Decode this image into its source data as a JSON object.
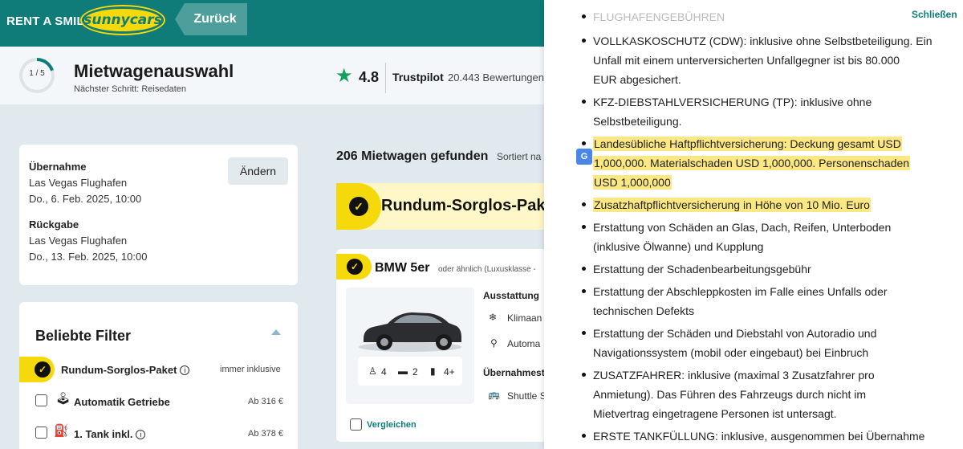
{
  "topbar": {
    "brand_text": "RENT A SMILE",
    "logo_text": "sunnycars",
    "back_label": "Zurück"
  },
  "header": {
    "step": "1 / 5",
    "progress_fraction": 0.2,
    "title": "Mietwagenauswahl",
    "next_step": "Nächster Schritt: Reisedaten",
    "rating": "4.8",
    "trustpilot_label": "Trustpilot",
    "reviews": "20.443 Bewertungen"
  },
  "rental": {
    "pickup_label": "Übernahme",
    "pickup_location": "Las Vegas Flughafen",
    "pickup_date": "Do., 6. Feb. 2025, 10:00",
    "return_label": "Rückgabe",
    "return_location": "Las Vegas Flughafen",
    "return_date": "Do., 13. Feb. 2025, 10:00",
    "change_label": "Ändern"
  },
  "filters": {
    "title": "Beliebte Filter",
    "items": [
      {
        "name": "Rundum-Sorglos-Paket",
        "extra": "immer inklusive"
      },
      {
        "name": "Automatik Getriebe",
        "extra": "Ab 316 €"
      },
      {
        "name": "1. Tank inkl.",
        "extra": "Ab 378 €"
      }
    ]
  },
  "results": {
    "count_text": "206 Mietwagen gefunden",
    "sorted_text": "Sortiert na",
    "package_title": "Rundum-Sorglos-Pak"
  },
  "car": {
    "name": "BMW 5er",
    "subtitle": "oder ähnlich (Luxusklasse -",
    "seats": "4",
    "bags": "2",
    "small_bags": "4+",
    "equipment_head": "Ausstattung",
    "feature1": "Klimaan",
    "feature2": "Automa",
    "pickup_head": "Übernahmest",
    "shuttle": "Shuttle S",
    "compare": "Vergleichen"
  },
  "panel": {
    "close_label": "Schließen",
    "lines": [
      "FLUGHAFENGEBÜHREN",
      "VOLLKASKOSCHUTZ (CDW): inklusive ohne Selbstbeteiligung. Ein",
      "Unfall mit einem unterversicherten Unfallgegner ist bis 80.000",
      "EUR abgesichert.",
      "KFZ-DIEBSTAHLVERSICHERUNG (TP): inklusive ohne",
      "Selbstbeteiligung.",
      "Landesübliche Haftpflichtversicherung: Deckung gesamt USD",
      "1,000,000. Materialschaden USD 1,000,000. Personenschaden",
      "USD 1,000,000",
      "Zusatzhaftpflichtversicherung in Höhe von 10 Mio. Euro",
      "Erstattung von Schäden an Glas, Dach, Reifen, Unterboden",
      "(inklusive Ölwanne) und Kupplung",
      "Erstattung der Schadenbearbeitungsgebühr",
      "Erstattung der Abschleppkosten im Falle eines Unfalls oder",
      "technischen Defekts",
      "Erstattung der Schäden und Diebstahl von Autoradio und",
      "Navigationssystem (mobil oder eingebaut) bei Einbruch",
      "ZUSATZFAHRER: inklusive (maximal 3 Zusatzfahrer pro",
      "Anmietung). Das Führen des Fahrzeugs durch nicht im",
      "Mietvertrag eingetragene Personen ist untersagt.",
      "ERSTE TANKFÜLLUNG: inklusive, ausgenommen bei Übernahme"
    ]
  },
  "colors": {
    "teal": "#0f7c79",
    "yellow": "#f5d90a",
    "highlight": "#fbe883",
    "trustpilot_green": "#12a05a"
  }
}
